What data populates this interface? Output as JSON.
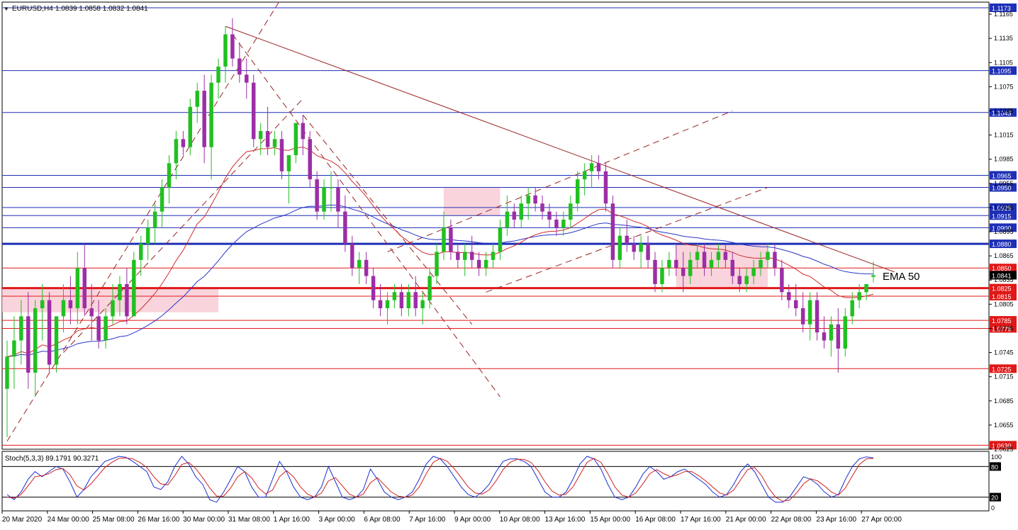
{
  "header": {
    "dropdown_icon": "triangle-down-icon",
    "symbol": "EURUSD,H4",
    "ohlc": "1.0839 1.0858 1.0832 1.0841"
  },
  "stoch_header": "Stoch(5,3,3) 89.1791 90.3271",
  "ema_label": "EMA 50",
  "colors": {
    "bull": "#21c021",
    "bear": "#9c2ea6",
    "blue_level": "#1d2fb5",
    "red_level": "#e01818",
    "ema_blue": "#2a35c8",
    "ema_red": "#d02a2a",
    "trend": "#9a2222",
    "zone": "#f7c9d3"
  },
  "chart_data": [
    {
      "type": "candlestick",
      "symbol": "EURUSD",
      "timeframe": "H4",
      "ylim": [
        1.0625,
        1.118
      ],
      "y_ticks": [
        "1.1165",
        "1.1135",
        "1.1105",
        "1.1075",
        "1.1045",
        "1.1015",
        "1.0985",
        "1.0955",
        "1.0925",
        "1.0895",
        "1.0865",
        "1.0835",
        "1.0805",
        "1.0775",
        "1.0745",
        "1.0715",
        "1.0685",
        "1.0655",
        "1.0625"
      ],
      "x_ticks": [
        "20 Mar 2020",
        "24 Mar 00:00",
        "25 Mar 08:00",
        "26 Mar 16:00",
        "30 Mar 00:00",
        "31 Mar 08:00",
        "1 Apr 16:00",
        "3 Apr 00:00",
        "6 Apr 08:00",
        "7 Apr 16:00",
        "9 Apr 00:00",
        "10 Apr 08:00",
        "13 Apr 16:00",
        "15 Apr 00:00",
        "16 Apr 08:00",
        "17 Apr 16:00",
        "21 Apr 00:00",
        "22 Apr 08:00",
        "23 Apr 16:00",
        "27 Apr 00:00"
      ],
      "levels": [
        {
          "value": 1.1173,
          "label": "1.1173",
          "kind": "blue"
        },
        {
          "value": 1.1095,
          "label": "1.1095",
          "kind": "blue"
        },
        {
          "value": 1.1043,
          "label": "1.1043",
          "kind": "blue"
        },
        {
          "value": 1.0965,
          "label": "1.0965",
          "kind": "blue"
        },
        {
          "value": 1.095,
          "label": "1.0950",
          "kind": "blue"
        },
        {
          "value": 1.0925,
          "label": "1.0925",
          "kind": "blue"
        },
        {
          "value": 1.0915,
          "label": "1.0915",
          "kind": "blue"
        },
        {
          "value": 1.09,
          "label": "1.0900",
          "kind": "blue"
        },
        {
          "value": 1.088,
          "label": "1.0880",
          "kind": "blue-bold"
        },
        {
          "value": 1.085,
          "label": "1.0850",
          "kind": "red"
        },
        {
          "value": 1.0825,
          "label": "1.0825",
          "kind": "red-bold"
        },
        {
          "value": 1.0815,
          "label": "1.0815",
          "kind": "red"
        },
        {
          "value": 1.0785,
          "label": "1.0785",
          "kind": "red"
        },
        {
          "value": 1.0775,
          "label": "1.0775",
          "kind": "red"
        },
        {
          "value": 1.0725,
          "label": "1.0725",
          "kind": "red"
        },
        {
          "value": 1.063,
          "label": "1.0630",
          "kind": "red"
        }
      ],
      "current_price": {
        "value": 1.0841,
        "label": "1.0841"
      },
      "ema_label": "EMA 50",
      "candles_ohlc": [
        [
          1.07,
          1.076,
          1.064,
          1.074
        ],
        [
          1.074,
          1.079,
          1.07,
          1.076
        ],
        [
          1.076,
          1.081,
          1.073,
          1.079
        ],
        [
          1.079,
          1.082,
          1.07,
          1.072
        ],
        [
          1.072,
          1.081,
          1.069,
          1.08
        ],
        [
          1.08,
          1.083,
          1.076,
          1.081
        ],
        [
          1.081,
          1.082,
          1.072,
          1.073
        ],
        [
          1.073,
          1.079,
          1.072,
          1.079
        ],
        [
          1.079,
          1.083,
          1.077,
          1.081
        ],
        [
          1.081,
          1.084,
          1.078,
          1.08
        ],
        [
          1.08,
          1.087,
          1.078,
          1.085
        ],
        [
          1.085,
          1.088,
          1.079,
          1.08
        ],
        [
          1.08,
          1.083,
          1.076,
          1.079
        ],
        [
          1.079,
          1.081,
          1.075,
          1.076
        ],
        [
          1.076,
          1.08,
          1.075,
          1.079
        ],
        [
          1.079,
          1.083,
          1.078,
          1.081
        ],
        [
          1.081,
          1.084,
          1.079,
          1.083
        ],
        [
          1.083,
          1.085,
          1.078,
          1.079
        ],
        [
          1.079,
          1.087,
          1.079,
          1.086
        ],
        [
          1.086,
          1.089,
          1.084,
          1.088
        ],
        [
          1.088,
          1.091,
          1.086,
          1.09
        ],
        [
          1.09,
          1.093,
          1.088,
          1.092
        ],
        [
          1.092,
          1.096,
          1.09,
          1.095
        ],
        [
          1.095,
          1.099,
          1.093,
          1.098
        ],
        [
          1.098,
          1.102,
          1.096,
          1.101
        ],
        [
          1.101,
          1.102,
          1.099,
          1.1
        ],
        [
          1.1,
          1.106,
          1.099,
          1.105
        ],
        [
          1.105,
          1.108,
          1.103,
          1.107
        ],
        [
          1.107,
          1.109,
          1.098,
          1.1
        ],
        [
          1.1,
          1.109,
          1.096,
          1.108
        ],
        [
          1.108,
          1.111,
          1.106,
          1.11
        ],
        [
          1.11,
          1.115,
          1.108,
          1.114
        ],
        [
          1.114,
          1.116,
          1.11,
          1.111
        ],
        [
          1.111,
          1.113,
          1.108,
          1.109
        ],
        [
          1.109,
          1.111,
          1.106,
          1.108
        ],
        [
          1.108,
          1.109,
          1.1,
          1.101
        ],
        [
          1.101,
          1.103,
          1.099,
          1.102
        ],
        [
          1.102,
          1.105,
          1.099,
          1.1
        ],
        [
          1.1,
          1.102,
          1.099,
          1.101
        ],
        [
          1.101,
          1.102,
          1.096,
          1.097
        ],
        [
          1.097,
          1.099,
          1.093,
          1.099
        ],
        [
          1.099,
          1.103,
          1.098,
          1.103
        ],
        [
          1.103,
          1.104,
          1.099,
          1.101
        ],
        [
          1.101,
          1.102,
          1.095,
          1.096
        ],
        [
          1.096,
          1.097,
          1.091,
          1.092
        ],
        [
          1.092,
          1.096,
          1.091,
          1.095
        ],
        [
          1.095,
          1.097,
          1.092,
          1.095
        ],
        [
          1.095,
          1.096,
          1.09,
          1.092
        ],
        [
          1.092,
          1.094,
          1.087,
          1.088
        ],
        [
          1.088,
          1.089,
          1.084,
          1.085
        ],
        [
          1.085,
          1.087,
          1.083,
          1.086
        ],
        [
          1.086,
          1.087,
          1.083,
          1.084
        ],
        [
          1.084,
          1.085,
          1.08,
          1.081
        ],
        [
          1.081,
          1.083,
          1.079,
          1.08
        ],
        [
          1.08,
          1.082,
          1.078,
          1.081
        ],
        [
          1.081,
          1.083,
          1.08,
          1.082
        ],
        [
          1.082,
          1.083,
          1.079,
          1.08
        ],
        [
          1.08,
          1.083,
          1.079,
          1.082
        ],
        [
          1.082,
          1.084,
          1.079,
          1.08
        ],
        [
          1.08,
          1.082,
          1.078,
          1.081
        ],
        [
          1.081,
          1.085,
          1.08,
          1.084
        ],
        [
          1.084,
          1.088,
          1.083,
          1.087
        ],
        [
          1.087,
          1.092,
          1.086,
          1.09
        ],
        [
          1.09,
          1.091,
          1.086,
          1.087
        ],
        [
          1.087,
          1.088,
          1.085,
          1.086
        ],
        [
          1.086,
          1.088,
          1.084,
          1.087
        ],
        [
          1.087,
          1.089,
          1.085,
          1.086
        ],
        [
          1.086,
          1.087,
          1.084,
          1.085
        ],
        [
          1.085,
          1.087,
          1.084,
          1.086
        ],
        [
          1.086,
          1.088,
          1.085,
          1.087
        ],
        [
          1.087,
          1.091,
          1.086,
          1.09
        ],
        [
          1.09,
          1.094,
          1.089,
          1.092
        ],
        [
          1.092,
          1.093,
          1.09,
          1.091
        ],
        [
          1.091,
          1.094,
          1.09,
          1.093
        ],
        [
          1.093,
          1.095,
          1.091,
          1.094
        ],
        [
          1.094,
          1.095,
          1.092,
          1.093
        ],
        [
          1.093,
          1.094,
          1.091,
          1.092
        ],
        [
          1.092,
          1.093,
          1.09,
          1.091
        ],
        [
          1.091,
          1.092,
          1.089,
          1.09
        ],
        [
          1.09,
          1.092,
          1.089,
          1.091
        ],
        [
          1.091,
          1.094,
          1.09,
          1.093
        ],
        [
          1.093,
          1.097,
          1.092,
          1.096
        ],
        [
          1.096,
          1.098,
          1.094,
          1.097
        ],
        [
          1.097,
          1.099,
          1.095,
          1.098
        ],
        [
          1.098,
          1.099,
          1.096,
          1.097
        ],
        [
          1.097,
          1.098,
          1.092,
          1.093
        ],
        [
          1.093,
          1.094,
          1.085,
          1.086
        ],
        [
          1.086,
          1.09,
          1.085,
          1.089
        ],
        [
          1.089,
          1.091,
          1.087,
          1.088
        ],
        [
          1.088,
          1.089,
          1.086,
          1.087
        ],
        [
          1.087,
          1.089,
          1.085,
          1.088
        ],
        [
          1.088,
          1.089,
          1.085,
          1.086
        ],
        [
          1.086,
          1.087,
          1.082,
          1.083
        ],
        [
          1.083,
          1.086,
          1.082,
          1.085
        ],
        [
          1.085,
          1.087,
          1.084,
          1.086
        ],
        [
          1.086,
          1.088,
          1.084,
          1.085
        ],
        [
          1.085,
          1.087,
          1.082,
          1.084
        ],
        [
          1.084,
          1.087,
          1.083,
          1.086
        ],
        [
          1.086,
          1.088,
          1.085,
          1.087
        ],
        [
          1.087,
          1.088,
          1.084,
          1.085
        ],
        [
          1.085,
          1.087,
          1.084,
          1.086
        ],
        [
          1.086,
          1.088,
          1.085,
          1.087
        ],
        [
          1.087,
          1.088,
          1.085,
          1.086
        ],
        [
          1.086,
          1.087,
          1.083,
          1.084
        ],
        [
          1.084,
          1.085,
          1.082,
          1.083
        ],
        [
          1.083,
          1.085,
          1.082,
          1.084
        ],
        [
          1.084,
          1.086,
          1.083,
          1.085
        ],
        [
          1.085,
          1.087,
          1.084,
          1.086
        ],
        [
          1.086,
          1.088,
          1.085,
          1.087
        ],
        [
          1.087,
          1.088,
          1.084,
          1.085
        ],
        [
          1.085,
          1.086,
          1.081,
          1.082
        ],
        [
          1.082,
          1.083,
          1.08,
          1.081
        ],
        [
          1.081,
          1.083,
          1.079,
          1.08
        ],
        [
          1.08,
          1.082,
          1.077,
          1.078
        ],
        [
          1.078,
          1.082,
          1.076,
          1.081
        ],
        [
          1.081,
          1.082,
          1.076,
          1.077
        ],
        [
          1.077,
          1.079,
          1.075,
          1.076
        ],
        [
          1.076,
          1.079,
          1.074,
          1.078
        ],
        [
          1.078,
          1.08,
          1.072,
          1.075
        ],
        [
          1.075,
          1.08,
          1.074,
          1.079
        ],
        [
          1.079,
          1.082,
          1.078,
          1.081
        ],
        [
          1.081,
          1.083,
          1.08,
          1.082
        ],
        [
          1.082,
          1.083,
          1.081,
          1.083
        ],
        [
          1.0839,
          1.0858,
          1.0832,
          1.0841
        ]
      ]
    },
    {
      "type": "line",
      "title": "Stoch(5,3,3) 89.1791 90.3271",
      "ylim": [
        0,
        100
      ],
      "y_ticks": [
        "100",
        "80",
        "20",
        "0"
      ],
      "levels": [
        80,
        20
      ],
      "series": [
        {
          "values": [
            25,
            15,
            30,
            55,
            70,
            60,
            70,
            80,
            75,
            50,
            20,
            35,
            60,
            75,
            90,
            95,
            100,
            98,
            90,
            80,
            70,
            40,
            35,
            50,
            80,
            100,
            85,
            60,
            45,
            15,
            10,
            30,
            55,
            80,
            70,
            40,
            20,
            20,
            55,
            90,
            70,
            40,
            20,
            15,
            20,
            40,
            80,
            50,
            20,
            15,
            20,
            35,
            75,
            55,
            30,
            20,
            15,
            20,
            30,
            55,
            85,
            100,
            95,
            80,
            60,
            40,
            25,
            20,
            30,
            45,
            70,
            90,
            95,
            95,
            90,
            80,
            55,
            30,
            20,
            20,
            30,
            55,
            85,
            100,
            95,
            75,
            45,
            20,
            15,
            20,
            40,
            65,
            80,
            70,
            55,
            60,
            70,
            75,
            65,
            55,
            45,
            30,
            20,
            25,
            45,
            70,
            85,
            70,
            45,
            20,
            10,
            10,
            20,
            40,
            60,
            55,
            45,
            30,
            20,
            25,
            55,
            80,
            95,
            99,
            97
          ]
        },
        {
          "values": [
            20,
            18,
            25,
            42,
            60,
            62,
            66,
            74,
            76,
            64,
            42,
            34,
            46,
            62,
            78,
            88,
            96,
            97,
            95,
            88,
            78,
            60,
            46,
            44,
            62,
            84,
            88,
            76,
            58,
            38,
            22,
            22,
            38,
            60,
            70,
            58,
            38,
            26,
            34,
            60,
            72,
            60,
            40,
            26,
            20,
            28,
            52,
            58,
            42,
            26,
            20,
            26,
            48,
            58,
            44,
            30,
            22,
            20,
            24,
            40,
            66,
            88,
            96,
            90,
            76,
            58,
            40,
            28,
            26,
            34,
            52,
            74,
            88,
            94,
            94,
            88,
            72,
            50,
            32,
            24,
            26,
            40,
            64,
            88,
            96,
            88,
            66,
            40,
            24,
            20,
            28,
            46,
            66,
            74,
            66,
            60,
            64,
            70,
            70,
            62,
            52,
            40,
            28,
            24,
            34,
            54,
            74,
            78,
            62,
            38,
            20,
            12,
            14,
            28,
            46,
            56,
            52,
            42,
            30,
            24,
            38,
            62,
            84,
            95,
            96
          ]
        }
      ]
    }
  ]
}
